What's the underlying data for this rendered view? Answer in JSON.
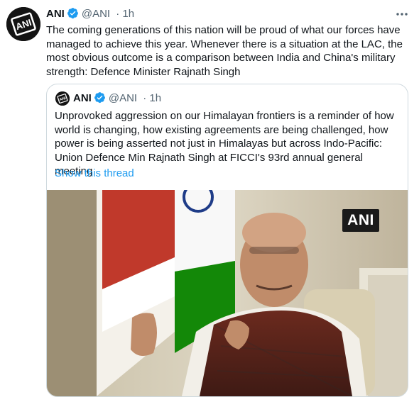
{
  "tweet": {
    "name": "ANI",
    "handle": "@ANI",
    "time": "· 1h",
    "avatar_logo": "ANI",
    "icons": {
      "verified": "verified-badge-icon",
      "more": "more-options-icon"
    },
    "text": "The coming generations of this nation will be proud of what our forces have managed to achieve this year. Whenever there is a situation at the LAC, the most obvious outcome is a comparison between India and China's military strength: Defence Minister Rajnath Singh"
  },
  "quote": {
    "name": "ANI",
    "handle": "@ANI",
    "time": "· 1h",
    "avatar_logo": "ANI",
    "text": "Unprovoked aggression on our Himalayan frontiers is a reminder of how world is changing, how existing agreements are being challenged, how power is being asserted not just in Himalayas but across Indo-Pacific: Union Defence Min Rajnath Singh at FICCI's 93rd annual general meeting",
    "link": "Show this thread",
    "media": {
      "watermark": "ANI"
    }
  },
  "colors": {
    "link": "#1d9bf0",
    "verified": "#1d9bf0",
    "secondary_text": "#536471",
    "border": "#cfd9de"
  }
}
